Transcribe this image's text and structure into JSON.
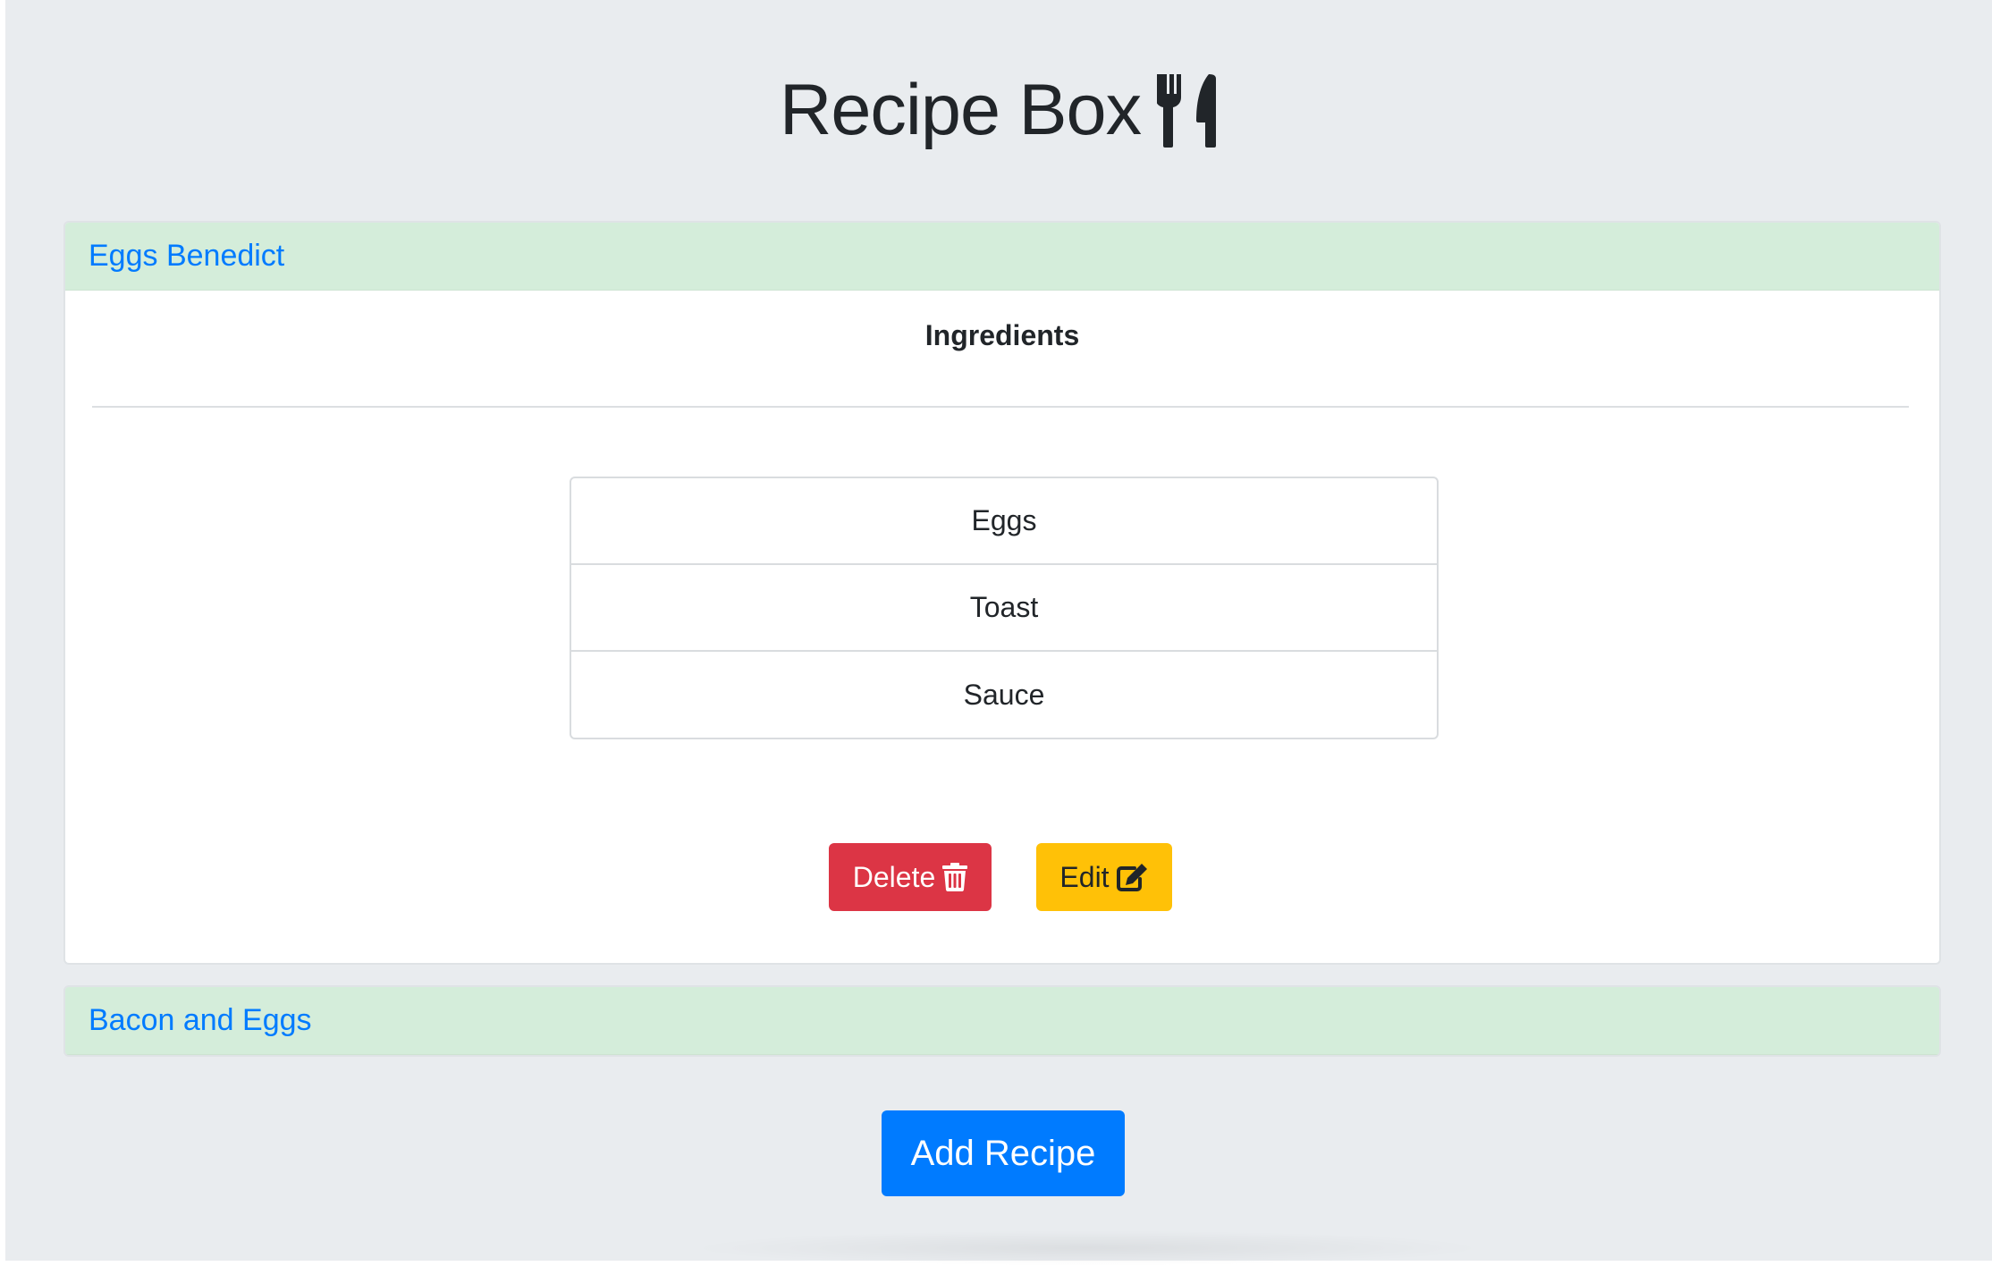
{
  "header": {
    "title": "Recipe Box",
    "title_icon": "utensils-icon"
  },
  "recipes": [
    {
      "name": "Eggs Benedict",
      "expanded": true,
      "ingredients_heading": "Ingredients",
      "ingredients": [
        "Eggs",
        "Toast",
        "Sauce"
      ],
      "delete_label": "Delete",
      "delete_icon": "trash-icon",
      "edit_label": "Edit",
      "edit_icon": "edit-icon"
    },
    {
      "name": "Bacon and Eggs",
      "expanded": false
    }
  ],
  "add_button_label": "Add Recipe",
  "colors": {
    "background": "#e9ecef",
    "card_header": "#d4edda",
    "link": "#007bff",
    "danger": "#dc3545",
    "warning": "#ffc107",
    "primary": "#007bff"
  }
}
